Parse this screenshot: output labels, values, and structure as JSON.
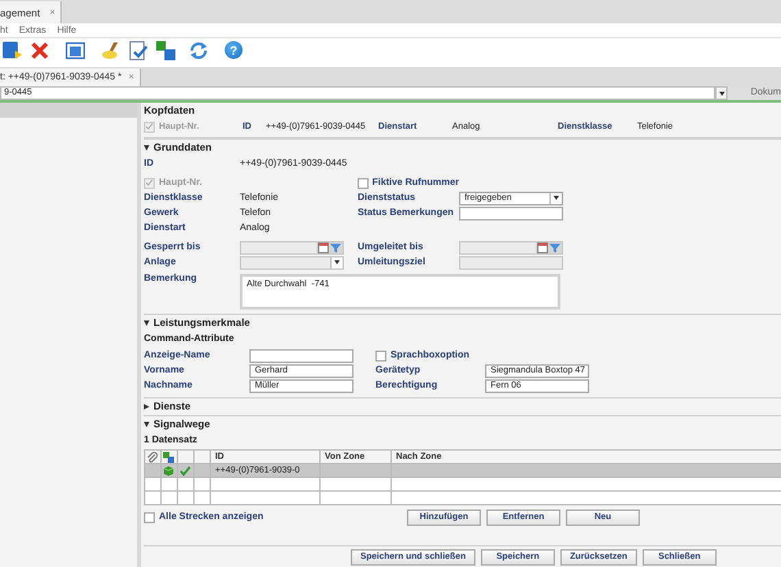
{
  "app_tab": {
    "label": "agement",
    "close": "×"
  },
  "menu": [
    "ht",
    "Extras",
    "Hilfe"
  ],
  "help_glyph": "?",
  "doc_tab": {
    "label": "t: ++49-(0)7961-9039-0445 *",
    "close": "×"
  },
  "address": {
    "value": "9-0445"
  },
  "side_label": "Dokum",
  "kopfdaten": {
    "title": "Kopfdaten",
    "haupt_nr": {
      "label": "Haupt-Nr.",
      "checked": true,
      "disabled": true
    },
    "fields": [
      {
        "label": "ID",
        "value": "++49-(0)7961-9039-0445"
      },
      {
        "label": "Dienstart",
        "value": "Analog"
      },
      {
        "label": "Dienstklasse",
        "value": "Telefonie"
      }
    ]
  },
  "sections": [
    {
      "title": "Grunddaten",
      "expanded": true,
      "kind": "form",
      "groups": [
        [
          [
            {
              "kind": "label",
              "text": "ID"
            },
            {
              "kind": "text",
              "text": "++49-(0)7961-9039-0445"
            }
          ]
        ],
        [
          [
            {
              "kind": "check",
              "label": "Haupt-Nr.",
              "checked": true,
              "disabled": true
            },
            {
              "kind": "blank"
            },
            {
              "kind": "check",
              "label": "Fiktive Rufnummer",
              "checked": false,
              "disabled": false
            }
          ],
          [
            {
              "kind": "label",
              "text": "Dienstklasse"
            },
            {
              "kind": "text",
              "text": "Telefonie"
            },
            {
              "kind": "label",
              "text": "Dienststatus"
            },
            {
              "kind": "select",
              "value": "freigegeben",
              "disabled": false
            }
          ],
          [
            {
              "kind": "label",
              "text": "Gewerk"
            },
            {
              "kind": "text",
              "text": "Telefon"
            },
            {
              "kind": "label",
              "text": "Status Bemerkungen"
            },
            {
              "kind": "input",
              "disabled": false
            }
          ],
          [
            {
              "kind": "label",
              "text": "Dienstart"
            },
            {
              "kind": "text",
              "text": "Analog"
            }
          ]
        ],
        [
          [
            {
              "kind": "label",
              "text": "Gesperrt bis"
            },
            {
              "kind": "date",
              "disabled": true
            },
            {
              "kind": "label",
              "text": "Umgeleitet bis"
            },
            {
              "kind": "date",
              "disabled": true
            }
          ],
          [
            {
              "kind": "label",
              "text": "Anlage"
            },
            {
              "kind": "select",
              "disabled": true
            },
            {
              "kind": "label",
              "text": "Umleitungsziel"
            },
            {
              "kind": "input",
              "disabled": true
            }
          ]
        ],
        [
          [
            {
              "kind": "label",
              "text": "Bemerkung"
            },
            {
              "kind": "textarea",
              "value": "Alte Durchwahl  -741"
            }
          ]
        ]
      ]
    },
    {
      "title": "Leistungsmerkmale",
      "expanded": true,
      "kind": "form",
      "subtitle": "Command-Attribute",
      "groups": [
        [
          [
            {
              "kind": "label",
              "text": "Anzeige-Name"
            },
            {
              "kind": "input",
              "disabled": false
            },
            {
              "kind": "check",
              "label": "Sprachboxoption",
              "checked": false,
              "disabled": false
            }
          ],
          [
            {
              "kind": "label",
              "text": "Vorname"
            },
            {
              "kind": "input",
              "value": "Gerhard",
              "disabled": false
            },
            {
              "kind": "label",
              "text": "Gerätetyp"
            },
            {
              "kind": "input",
              "value": "Siegmandula Boxtop 47",
              "disabled": false
            }
          ],
          [
            {
              "kind": "label",
              "text": "Nachname"
            },
            {
              "kind": "input",
              "value": "Müller",
              "disabled": false
            },
            {
              "kind": "label",
              "text": "Berechtigung"
            },
            {
              "kind": "input",
              "value": "Fern 06",
              "disabled": false
            }
          ]
        ]
      ]
    },
    {
      "title": "Dienste",
      "expanded": false,
      "kind": "empty"
    },
    {
      "title": "Signalwege",
      "expanded": true,
      "kind": "table",
      "count": "1 Datensatz",
      "columns": [
        "ID",
        "Von Zone",
        "Nach Zone"
      ],
      "rows": [
        {
          "selected": true,
          "active": true,
          "checked": true,
          "id": "++49-(0)7961-9039-0"
        }
      ],
      "show_all": {
        "label": "Alle Strecken anzeigen",
        "checked": false
      },
      "buttons": [
        "Hinzufügen",
        "Entfernen",
        "Neu"
      ]
    }
  ],
  "footer_buttons": [
    "Speichern und schließen",
    "Speichern",
    "Zurücksetzen",
    "Schließen"
  ]
}
